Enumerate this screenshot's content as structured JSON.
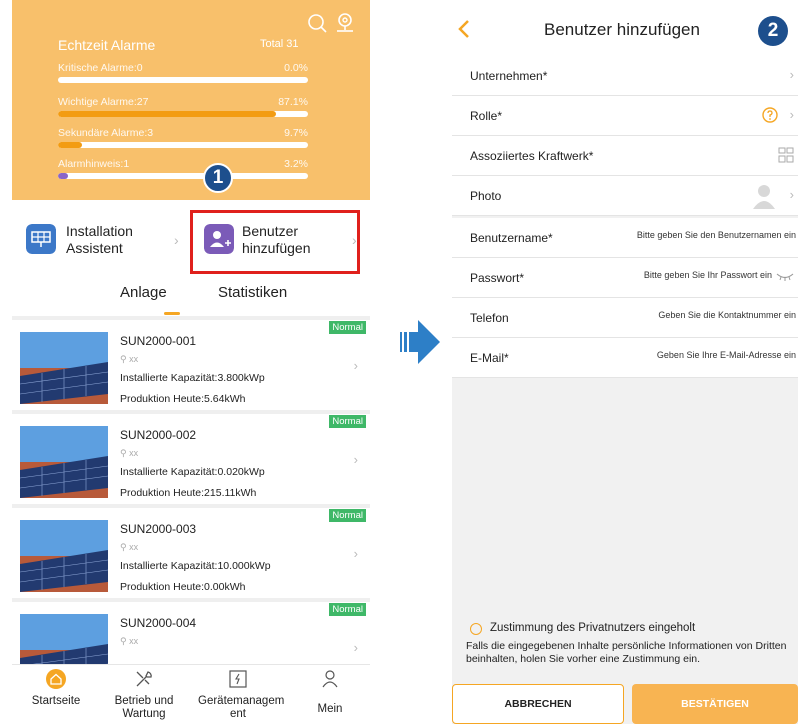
{
  "left": {
    "alarms": {
      "title": "Echtzeit Alarme",
      "total": "Total 31",
      "rows": [
        {
          "label": "Kritische Alarme:0",
          "pct": "0.0%",
          "fraction": 0.0,
          "color": "#f39c12"
        },
        {
          "label": "Wichtige Alarme:27",
          "pct": "87.1%",
          "fraction": 0.871,
          "color": "#f39c12"
        },
        {
          "label": "Sekundäre Alarme:3",
          "pct": "9.7%",
          "fraction": 0.097,
          "color": "#f39c12"
        },
        {
          "label": "Alarmhinweis:1",
          "pct": "3.2%",
          "fraction": 0.032,
          "color": "#8a66c8"
        }
      ]
    },
    "step_marker": "1",
    "shortcuts": {
      "installation": "Installation Assistent",
      "add_user": "Benutzer hinzufügen"
    },
    "tabs": [
      "Anlage",
      "Statistiken"
    ],
    "plants": [
      {
        "name": "SUN2000-001",
        "location": "xx",
        "capacity": "Installierte Kapazität:3.800kWp",
        "production": "Produktion Heute:5.64kWh",
        "status": "Normal"
      },
      {
        "name": "SUN2000-002",
        "location": "xx",
        "capacity": "Installierte Kapazität:0.020kWp",
        "production": "Produktion Heute:215.11kWh",
        "status": "Normal"
      },
      {
        "name": "SUN2000-003",
        "location": "xx",
        "capacity": "Installierte Kapazität:10.000kWp",
        "production": "Produktion Heute:0.00kWh",
        "status": "Normal"
      },
      {
        "name": "SUN2000-004",
        "location": "xx",
        "capacity": "",
        "production": "",
        "status": "Normal"
      }
    ],
    "nav": [
      {
        "label": "Startseite",
        "icon": "home-icon"
      },
      {
        "label": "Betrieb und Wartung",
        "icon": "tools-icon"
      },
      {
        "label": "Gerätemanagem ent",
        "icon": "device-icon"
      },
      {
        "label": "Mein",
        "icon": "user-icon"
      }
    ]
  },
  "right": {
    "title": "Benutzer hinzufügen",
    "step_marker": "2",
    "fields": [
      {
        "label": "Unternehmen*",
        "placeholder": ""
      },
      {
        "label": "Rolle*",
        "placeholder": ""
      },
      {
        "label": "Assoziiertes Kraftwerk*",
        "placeholder": ""
      },
      {
        "label": "Photo",
        "placeholder": ""
      },
      {
        "label": "Benutzername*",
        "placeholder": "Bitte geben Sie den Benutzernamen ein"
      },
      {
        "label": "Passwort*",
        "placeholder": "Bitte geben Sie Ihr Passwort ein"
      },
      {
        "label": "Telefon",
        "placeholder": "Geben Sie die Kontaktnummer ein"
      },
      {
        "label": "E-Mail*",
        "placeholder": "Geben Sie Ihre E-Mail-Adresse ein"
      }
    ],
    "consent_label": "Zustimmung des Privatnutzers eingeholt",
    "consent_note": "Falls die eingegebenen Inhalte persönliche Informationen von Dritten beinhalten, holen Sie vorher eine Zustimmung ein.",
    "cancel_label": "ABBRECHEN",
    "confirm_label": "BESTÄTIGEN"
  },
  "colors": {
    "accent": "#f5a623",
    "alarm_panel": "#f8c06b",
    "status_normal": "#3fb868",
    "step_marker": "#1d4f8d",
    "highlight": "#e0201c"
  }
}
